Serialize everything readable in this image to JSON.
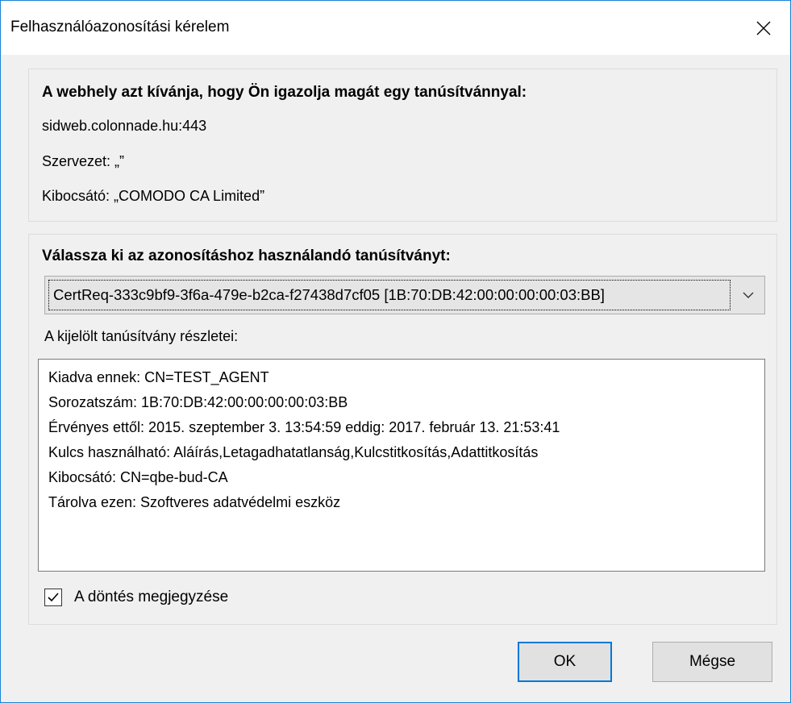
{
  "window": {
    "title": "Felhasználóazonosítási kérelem"
  },
  "site_info": {
    "heading": "A webhely azt kívánja, hogy Ön igazolja magát egy tanúsítvánnyal:",
    "host": "sidweb.colonnade.hu:443",
    "organization": "Szervezet: „”",
    "issuer": "Kibocsátó: „COMODO CA Limited”"
  },
  "cert_select": {
    "heading": "Válassza ki az azonosításhoz használandó tanúsítványt:",
    "selected": "CertReq-333c9bf9-3f6a-479e-b2ca-f27438d7cf05 [1B:70:DB:42:00:00:00:00:03:BB]",
    "details_label": "A kijelölt tanúsítvány részletei:",
    "details": [
      "Kiadva ennek: CN=TEST_AGENT",
      "Sorozatszám: 1B:70:DB:42:00:00:00:00:03:BB",
      "Érvényes ettől: 2015. szeptember 3. 13:54:59 eddig: 2017. február 13. 21:53:41",
      "Kulcs használható: Aláírás,Letagadhatatlanság,Kulcstitkosítás,Adattitkosítás",
      "Kibocsátó: CN=qbe-bud-CA",
      "Tárolva ezen: Szoftveres adatvédelmi eszköz"
    ]
  },
  "remember": {
    "label": "A döntés megjegyzése",
    "checked": true
  },
  "buttons": {
    "ok": "OK",
    "cancel": "Mégse"
  },
  "colors": {
    "window_border": "#1883d7",
    "ok_focus": "#0078d7"
  }
}
